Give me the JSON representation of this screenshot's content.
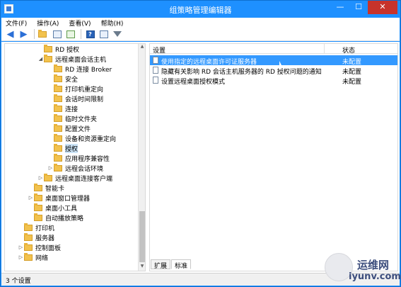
{
  "window": {
    "title": "组策略管理编辑器",
    "min": "—",
    "max": "☐",
    "close": "✕"
  },
  "menu": [
    "文件(F)",
    "操作(A)",
    "查看(V)",
    "帮助(H)"
  ],
  "tree": [
    {
      "label": "RD 授权",
      "indent": 0,
      "expander": "",
      "icon": true
    },
    {
      "label": "远程桌面会话主机",
      "indent": 0,
      "expander": "◢",
      "icon": true
    },
    {
      "label": "RD 连接 Broker",
      "indent": 1,
      "expander": "",
      "icon": true
    },
    {
      "label": "安全",
      "indent": 1,
      "expander": "",
      "icon": true
    },
    {
      "label": "打印机重定向",
      "indent": 1,
      "expander": "",
      "icon": true
    },
    {
      "label": "会话时间限制",
      "indent": 1,
      "expander": "",
      "icon": true
    },
    {
      "label": "连接",
      "indent": 1,
      "expander": "",
      "icon": true
    },
    {
      "label": "临时文件夹",
      "indent": 1,
      "expander": "",
      "icon": true
    },
    {
      "label": "配置文件",
      "indent": 1,
      "expander": "",
      "icon": true
    },
    {
      "label": "设备和资源重定向",
      "indent": 1,
      "expander": "",
      "icon": true
    },
    {
      "label": "授权",
      "indent": 1,
      "expander": "",
      "icon": true,
      "selected": true
    },
    {
      "label": "应用程序兼容性",
      "indent": 1,
      "expander": "",
      "icon": true
    },
    {
      "label": "远程会话环境",
      "indent": 1,
      "expander": "▷",
      "icon": true
    },
    {
      "label": "远程桌面连接客户端",
      "indent": 0,
      "expander": "▷",
      "icon": true
    },
    {
      "label": "智能卡",
      "indent": -1,
      "expander": "",
      "icon": true
    },
    {
      "label": "桌面窗口管理器",
      "indent": -1,
      "expander": "▷",
      "icon": true
    },
    {
      "label": "桌面小工具",
      "indent": -1,
      "expander": "",
      "icon": true
    },
    {
      "label": "自动播放策略",
      "indent": -1,
      "expander": "",
      "icon": true
    },
    {
      "label": "打印机",
      "indent": -2,
      "expander": "",
      "icon": true
    },
    {
      "label": "服务器",
      "indent": -2,
      "expander": "",
      "icon": true
    },
    {
      "label": "控制面板",
      "indent": -2,
      "expander": "▷",
      "icon": true
    },
    {
      "label": "网络",
      "indent": -2,
      "expander": "▷",
      "icon": true
    }
  ],
  "list": {
    "col_setting": "设置",
    "col_state": "状态",
    "rows": [
      {
        "name": "使用指定的远程桌面许可证服务器",
        "state": "未配置",
        "selected": true
      },
      {
        "name": "隐藏有关影响 RD 会话主机服务器的 RD 授权问题的通知",
        "state": "未配置"
      },
      {
        "name": "设置远程桌面授权模式",
        "state": "未配置"
      }
    ]
  },
  "tabs": [
    "扩展",
    "标准"
  ],
  "status": "3 个设置",
  "watermark": {
    "line1": "运维网",
    "line2": "iyunv.com"
  }
}
